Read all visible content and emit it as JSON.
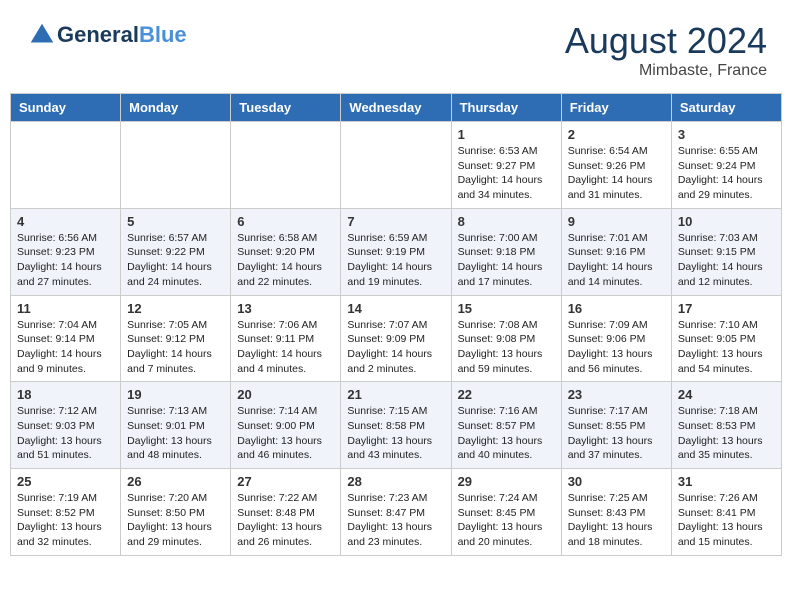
{
  "header": {
    "logo_line1": "General",
    "logo_line2": "Blue",
    "month_year": "August 2024",
    "location": "Mimbaste, France"
  },
  "weekdays": [
    "Sunday",
    "Monday",
    "Tuesday",
    "Wednesday",
    "Thursday",
    "Friday",
    "Saturday"
  ],
  "weeks": [
    [
      {
        "day": "",
        "info": ""
      },
      {
        "day": "",
        "info": ""
      },
      {
        "day": "",
        "info": ""
      },
      {
        "day": "",
        "info": ""
      },
      {
        "day": "1",
        "info": "Sunrise: 6:53 AM\nSunset: 9:27 PM\nDaylight: 14 hours\nand 34 minutes."
      },
      {
        "day": "2",
        "info": "Sunrise: 6:54 AM\nSunset: 9:26 PM\nDaylight: 14 hours\nand 31 minutes."
      },
      {
        "day": "3",
        "info": "Sunrise: 6:55 AM\nSunset: 9:24 PM\nDaylight: 14 hours\nand 29 minutes."
      }
    ],
    [
      {
        "day": "4",
        "info": "Sunrise: 6:56 AM\nSunset: 9:23 PM\nDaylight: 14 hours\nand 27 minutes."
      },
      {
        "day": "5",
        "info": "Sunrise: 6:57 AM\nSunset: 9:22 PM\nDaylight: 14 hours\nand 24 minutes."
      },
      {
        "day": "6",
        "info": "Sunrise: 6:58 AM\nSunset: 9:20 PM\nDaylight: 14 hours\nand 22 minutes."
      },
      {
        "day": "7",
        "info": "Sunrise: 6:59 AM\nSunset: 9:19 PM\nDaylight: 14 hours\nand 19 minutes."
      },
      {
        "day": "8",
        "info": "Sunrise: 7:00 AM\nSunset: 9:18 PM\nDaylight: 14 hours\nand 17 minutes."
      },
      {
        "day": "9",
        "info": "Sunrise: 7:01 AM\nSunset: 9:16 PM\nDaylight: 14 hours\nand 14 minutes."
      },
      {
        "day": "10",
        "info": "Sunrise: 7:03 AM\nSunset: 9:15 PM\nDaylight: 14 hours\nand 12 minutes."
      }
    ],
    [
      {
        "day": "11",
        "info": "Sunrise: 7:04 AM\nSunset: 9:14 PM\nDaylight: 14 hours\nand 9 minutes."
      },
      {
        "day": "12",
        "info": "Sunrise: 7:05 AM\nSunset: 9:12 PM\nDaylight: 14 hours\nand 7 minutes."
      },
      {
        "day": "13",
        "info": "Sunrise: 7:06 AM\nSunset: 9:11 PM\nDaylight: 14 hours\nand 4 minutes."
      },
      {
        "day": "14",
        "info": "Sunrise: 7:07 AM\nSunset: 9:09 PM\nDaylight: 14 hours\nand 2 minutes."
      },
      {
        "day": "15",
        "info": "Sunrise: 7:08 AM\nSunset: 9:08 PM\nDaylight: 13 hours\nand 59 minutes."
      },
      {
        "day": "16",
        "info": "Sunrise: 7:09 AM\nSunset: 9:06 PM\nDaylight: 13 hours\nand 56 minutes."
      },
      {
        "day": "17",
        "info": "Sunrise: 7:10 AM\nSunset: 9:05 PM\nDaylight: 13 hours\nand 54 minutes."
      }
    ],
    [
      {
        "day": "18",
        "info": "Sunrise: 7:12 AM\nSunset: 9:03 PM\nDaylight: 13 hours\nand 51 minutes."
      },
      {
        "day": "19",
        "info": "Sunrise: 7:13 AM\nSunset: 9:01 PM\nDaylight: 13 hours\nand 48 minutes."
      },
      {
        "day": "20",
        "info": "Sunrise: 7:14 AM\nSunset: 9:00 PM\nDaylight: 13 hours\nand 46 minutes."
      },
      {
        "day": "21",
        "info": "Sunrise: 7:15 AM\nSunset: 8:58 PM\nDaylight: 13 hours\nand 43 minutes."
      },
      {
        "day": "22",
        "info": "Sunrise: 7:16 AM\nSunset: 8:57 PM\nDaylight: 13 hours\nand 40 minutes."
      },
      {
        "day": "23",
        "info": "Sunrise: 7:17 AM\nSunset: 8:55 PM\nDaylight: 13 hours\nand 37 minutes."
      },
      {
        "day": "24",
        "info": "Sunrise: 7:18 AM\nSunset: 8:53 PM\nDaylight: 13 hours\nand 35 minutes."
      }
    ],
    [
      {
        "day": "25",
        "info": "Sunrise: 7:19 AM\nSunset: 8:52 PM\nDaylight: 13 hours\nand 32 minutes."
      },
      {
        "day": "26",
        "info": "Sunrise: 7:20 AM\nSunset: 8:50 PM\nDaylight: 13 hours\nand 29 minutes."
      },
      {
        "day": "27",
        "info": "Sunrise: 7:22 AM\nSunset: 8:48 PM\nDaylight: 13 hours\nand 26 minutes."
      },
      {
        "day": "28",
        "info": "Sunrise: 7:23 AM\nSunset: 8:47 PM\nDaylight: 13 hours\nand 23 minutes."
      },
      {
        "day": "29",
        "info": "Sunrise: 7:24 AM\nSunset: 8:45 PM\nDaylight: 13 hours\nand 20 minutes."
      },
      {
        "day": "30",
        "info": "Sunrise: 7:25 AM\nSunset: 8:43 PM\nDaylight: 13 hours\nand 18 minutes."
      },
      {
        "day": "31",
        "info": "Sunrise: 7:26 AM\nSunset: 8:41 PM\nDaylight: 13 hours\nand 15 minutes."
      }
    ]
  ]
}
